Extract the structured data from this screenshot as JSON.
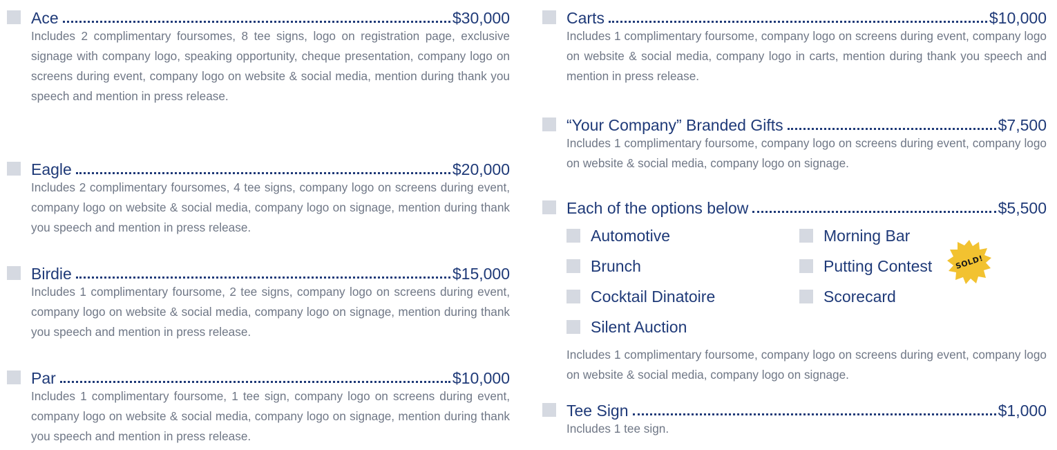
{
  "left_tiers": [
    {
      "name": "Ace",
      "price": "$30,000",
      "description": "Includes 2 complimentary foursomes, 8 tee signs, logo on registration page, exclusive signage with company logo, speaking opportunity, cheque presentation, company logo on screens during event, company logo on website & social media, mention during thank you speech and mention in press release."
    },
    {
      "name": "Eagle",
      "price": "$20,000",
      "description": "Includes 2 complimentary foursomes, 4 tee signs, company logo on screens during event, company logo on website & social media, company logo on signage, mention during thank you speech and mention in press release."
    },
    {
      "name": "Birdie",
      "price": "$15,000",
      "description": "Includes 1 complimentary foursome, 2 tee signs, company logo on screens during event, company logo on website & social media, company logo on signage, mention during thank you speech and mention in press release."
    },
    {
      "name": "Par",
      "price": "$10,000",
      "description": "Includes 1 complimentary foursome, 1 tee sign, company logo on screens during event, company logo on website & social media, company logo on signage, mention during thank you speech and mention in press release."
    }
  ],
  "right_tiers": {
    "carts": {
      "name": "Carts",
      "price": "$10,000",
      "description": "Includes 1 complimentary foursome, company logo on screens during event, company logo on website & social media, company logo in carts, mention during thank you speech and mention in press release."
    },
    "gifts": {
      "name": "“Your Company” Branded Gifts",
      "price": "$7,500",
      "description": "Includes 1 complimentary foursome, company logo on screens during event, company logo on website & social media, company logo on signage."
    },
    "options": {
      "name": "Each of the options below",
      "price": "$5,500",
      "items": [
        "Automotive",
        "Morning Bar",
        "Brunch",
        "Putting Contest",
        "Cocktail Dinatoire",
        "Scorecard",
        "Silent Auction"
      ],
      "sold_badge": "SOLD!",
      "description": "Includes 1 complimentary foursome, company logo on screens during event, company logo on website & social media, company logo on signage."
    },
    "tee_sign": {
      "name": "Tee Sign",
      "price": "$1,000",
      "description": "Includes 1 tee sign."
    }
  },
  "colors": {
    "heading": "#1f3a78",
    "body_text": "#6f7786",
    "checkbox": "#d5d9e1",
    "sold_badge": "#f2c230"
  }
}
